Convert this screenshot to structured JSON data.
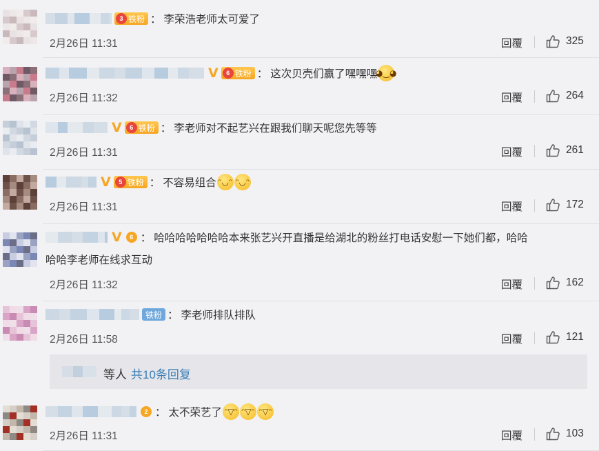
{
  "comments": [
    {
      "badge": "3",
      "badge_text": "铁粉",
      "vip": false,
      "text": "李荣浩老师太可爱了",
      "text2": "",
      "emojis": [],
      "date": "2月26日 11:31",
      "reply": "回覆",
      "likes": "325"
    },
    {
      "badge": "6",
      "badge_text": "铁粉",
      "vip": true,
      "text": "这次贝壳们赢了嘿嘿嘿",
      "text2": "",
      "emojis": [
        "😏"
      ],
      "date": "2月26日 11:32",
      "reply": "回覆",
      "likes": "264"
    },
    {
      "badge": "6",
      "badge_text": "铁粉",
      "vip": true,
      "text": "李老师对不起艺兴在跟我们聊天呢您先等等",
      "text2": "",
      "emojis": [],
      "date": "2月26日 11:31",
      "reply": "回覆",
      "likes": "261"
    },
    {
      "badge": "5",
      "badge_text": "铁粉",
      "vip": true,
      "text": "不容易组合",
      "text2": "",
      "emojis": [
        "😂",
        "😂"
      ],
      "date": "2月26日 11:31",
      "reply": "回覆",
      "likes": "172"
    },
    {
      "badge": "6",
      "badge_text": "",
      "vip": true,
      "text": "哈哈哈哈哈哈哈本来张艺兴开直播是给湖北的粉丝打电话安慰一下她们都，哈哈",
      "text2": "哈哈李老师在线求互动",
      "emojis": [],
      "date": "2月26日 11:32",
      "reply": "回覆",
      "likes": "162"
    },
    {
      "badge": "",
      "badge_text": "铁粉",
      "vip": false,
      "text": "李老师排队排队",
      "text2": "",
      "emojis": [],
      "date": "2月26日 11:58",
      "reply": "回覆",
      "likes": "121"
    },
    {
      "badge": "2",
      "badge_text": "",
      "vip": false,
      "text": "太不荣艺了",
      "text2": "",
      "emojis": [
        "😄",
        "😄",
        "😄"
      ],
      "date": "2月26日 11:31",
      "reply": "回覆",
      "likes": "103"
    }
  ],
  "subreplies": {
    "others": "等人",
    "more": "共10条回复"
  },
  "colors": {
    "link": "#3c7fb6",
    "vip": "#f5a623",
    "badge": "#f6a623",
    "background": "#f2f2f5"
  },
  "icons": {
    "like": "thumbs-up-icon",
    "vip": "vip-v-icon",
    "fan": "crown-icon"
  }
}
